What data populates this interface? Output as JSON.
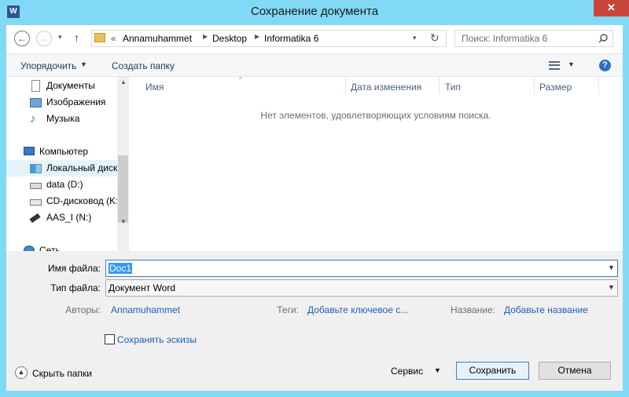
{
  "window": {
    "title": "Сохранение документа",
    "app_icon": "W",
    "close": "✕"
  },
  "nav": {
    "back": "←",
    "forward": "→",
    "up": "↑",
    "breadcrumb": {
      "prefix": "«",
      "parts": [
        "Annamuhammet",
        "Desktop",
        "Informatika 6"
      ]
    },
    "search_placeholder": "Поиск: Informatika 6"
  },
  "toolbar": {
    "organize": "Упорядочить",
    "new_folder": "Создать папку",
    "help": "?"
  },
  "sidebar": {
    "items": [
      {
        "label": "Документы",
        "icon": "documents-icon"
      },
      {
        "label": "Изображения",
        "icon": "pictures-icon"
      },
      {
        "label": "Музыка",
        "icon": "music-icon"
      },
      {
        "label": "Компьютер",
        "icon": "computer-icon"
      },
      {
        "label": "Локальный диск",
        "icon": "local-disk-icon"
      },
      {
        "label": "data (D:)",
        "icon": "drive-icon"
      },
      {
        "label": "CD-дисковод (K:",
        "icon": "cd-drive-icon"
      },
      {
        "label": "AAS_I (N:)",
        "icon": "usb-drive-icon"
      },
      {
        "label": "Сеть",
        "icon": "network-icon"
      }
    ]
  },
  "filelist": {
    "columns": [
      "Имя",
      "Дата изменения",
      "Тип",
      "Размер"
    ],
    "empty_message": "Нет элементов, удовлетворяющих условиям поиска."
  },
  "form": {
    "filename_label": "Имя файла:",
    "filename_value": "Doc1",
    "filetype_label": "Тип файла:",
    "filetype_value": "Документ Word",
    "authors_label": "Авторы:",
    "authors_value": "Annamuhammet",
    "tags_label": "Теги:",
    "tags_value": "Добавьте ключевое с...",
    "title_label": "Название:",
    "title_value": "Добавьте название",
    "thumbnail_label": "Сохранять эскизы"
  },
  "footer": {
    "hide_folders": "Скрыть папки",
    "tools": "Сервис",
    "save": "Сохранить",
    "cancel": "Отмена"
  },
  "colors": {
    "frame": "#82d9f6",
    "close": "#c7463b",
    "link": "#1e5fb3",
    "selection": "#3399ff"
  }
}
